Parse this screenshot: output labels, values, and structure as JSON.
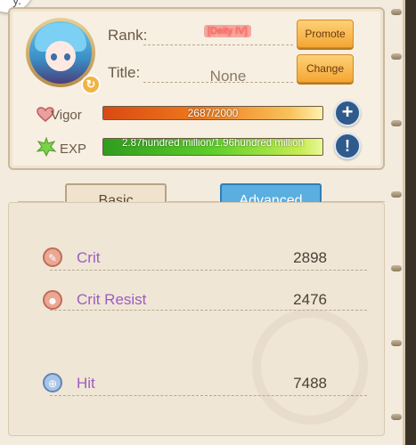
{
  "bubble": {
    "text": "y."
  },
  "profile": {
    "rank_label": "Rank:",
    "rank_value": "[Deity IV]",
    "title_label": "Title:",
    "title_value": "None",
    "promote_label": "Promote",
    "change_label": "Change"
  },
  "stats": {
    "vigor_label": "Vigor",
    "vigor_text": "2687/2000",
    "vigor_fill_fraction": 1.0,
    "exp_label": "EXP",
    "exp_text": "2.87hundred million/1.96hundred million",
    "exp_fill_fraction": 1.0
  },
  "tabs": {
    "basic": "Basic",
    "advanced": "Advanced",
    "active": "advanced"
  },
  "attributes": [
    {
      "name": "Crit",
      "value": "2898",
      "icon": "crit-icon"
    },
    {
      "name": "Crit Resist",
      "value": "2476",
      "icon": "crit-resist-icon"
    },
    {
      "name": "Hit",
      "value": "7488",
      "icon": "hit-icon"
    }
  ],
  "colors": {
    "vigor_bar": "#f07a1c",
    "exp_bar": "#5ecf2a",
    "active_tab": "#5aaee0",
    "attribute_name": "#9e5cc0",
    "rank_text": "#ff6a6a"
  }
}
